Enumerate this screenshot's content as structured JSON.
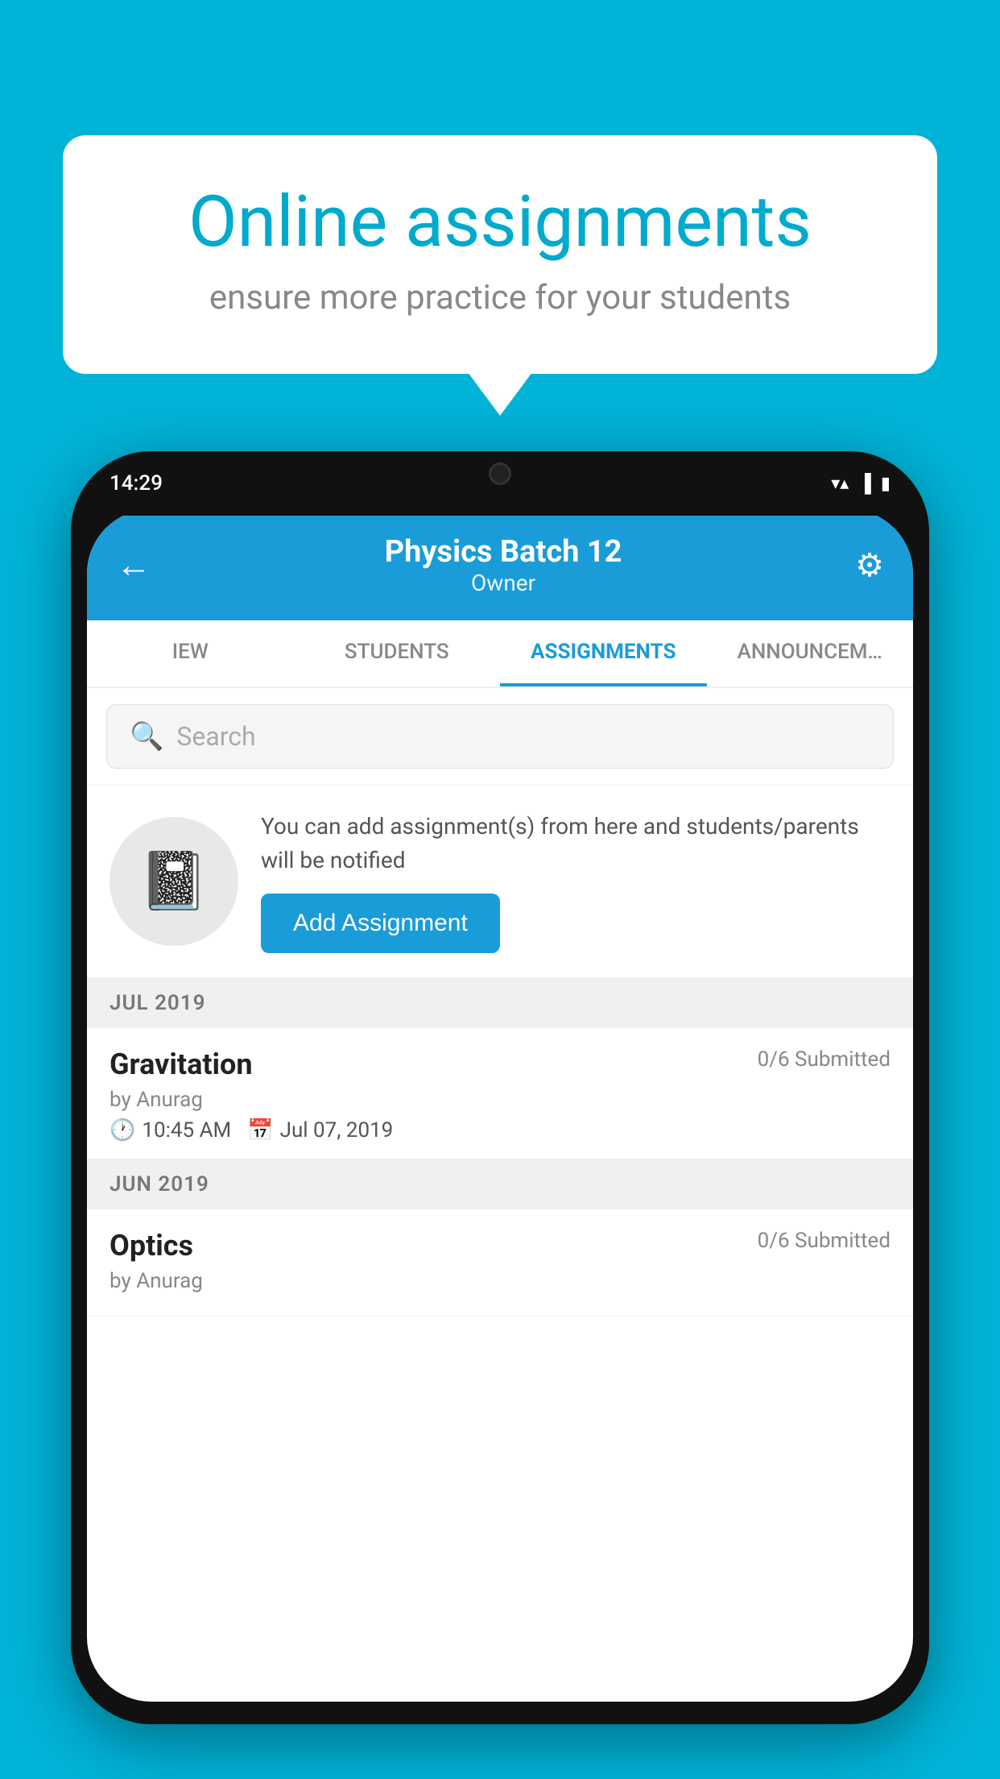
{
  "background_color": "#00B4D8",
  "speech_bubble": {
    "title": "Online assignments",
    "subtitle": "ensure more practice for your students"
  },
  "phone": {
    "status_bar": {
      "time": "14:29",
      "icons": [
        "wifi",
        "signal",
        "battery"
      ]
    },
    "header": {
      "title": "Physics Batch 12",
      "subtitle": "Owner",
      "back_label": "←",
      "settings_label": "⚙"
    },
    "tabs": [
      {
        "label": "IEW",
        "active": false
      },
      {
        "label": "STUDENTS",
        "active": false
      },
      {
        "label": "ASSIGNMENTS",
        "active": true
      },
      {
        "label": "ANNOUNCEM…",
        "active": false
      }
    ],
    "search": {
      "placeholder": "Search"
    },
    "info_card": {
      "text": "You can add assignment(s) from here and students/parents will be notified",
      "button_label": "Add Assignment"
    },
    "sections": [
      {
        "month": "JUL 2019",
        "assignments": [
          {
            "title": "Gravitation",
            "submitted": "0/6 Submitted",
            "author": "by Anurag",
            "time": "10:45 AM",
            "date": "Jul 07, 2019"
          }
        ]
      },
      {
        "month": "JUN 2019",
        "assignments": [
          {
            "title": "Optics",
            "submitted": "0/6 Submitted",
            "author": "by Anurag",
            "time": "",
            "date": ""
          }
        ]
      }
    ]
  }
}
